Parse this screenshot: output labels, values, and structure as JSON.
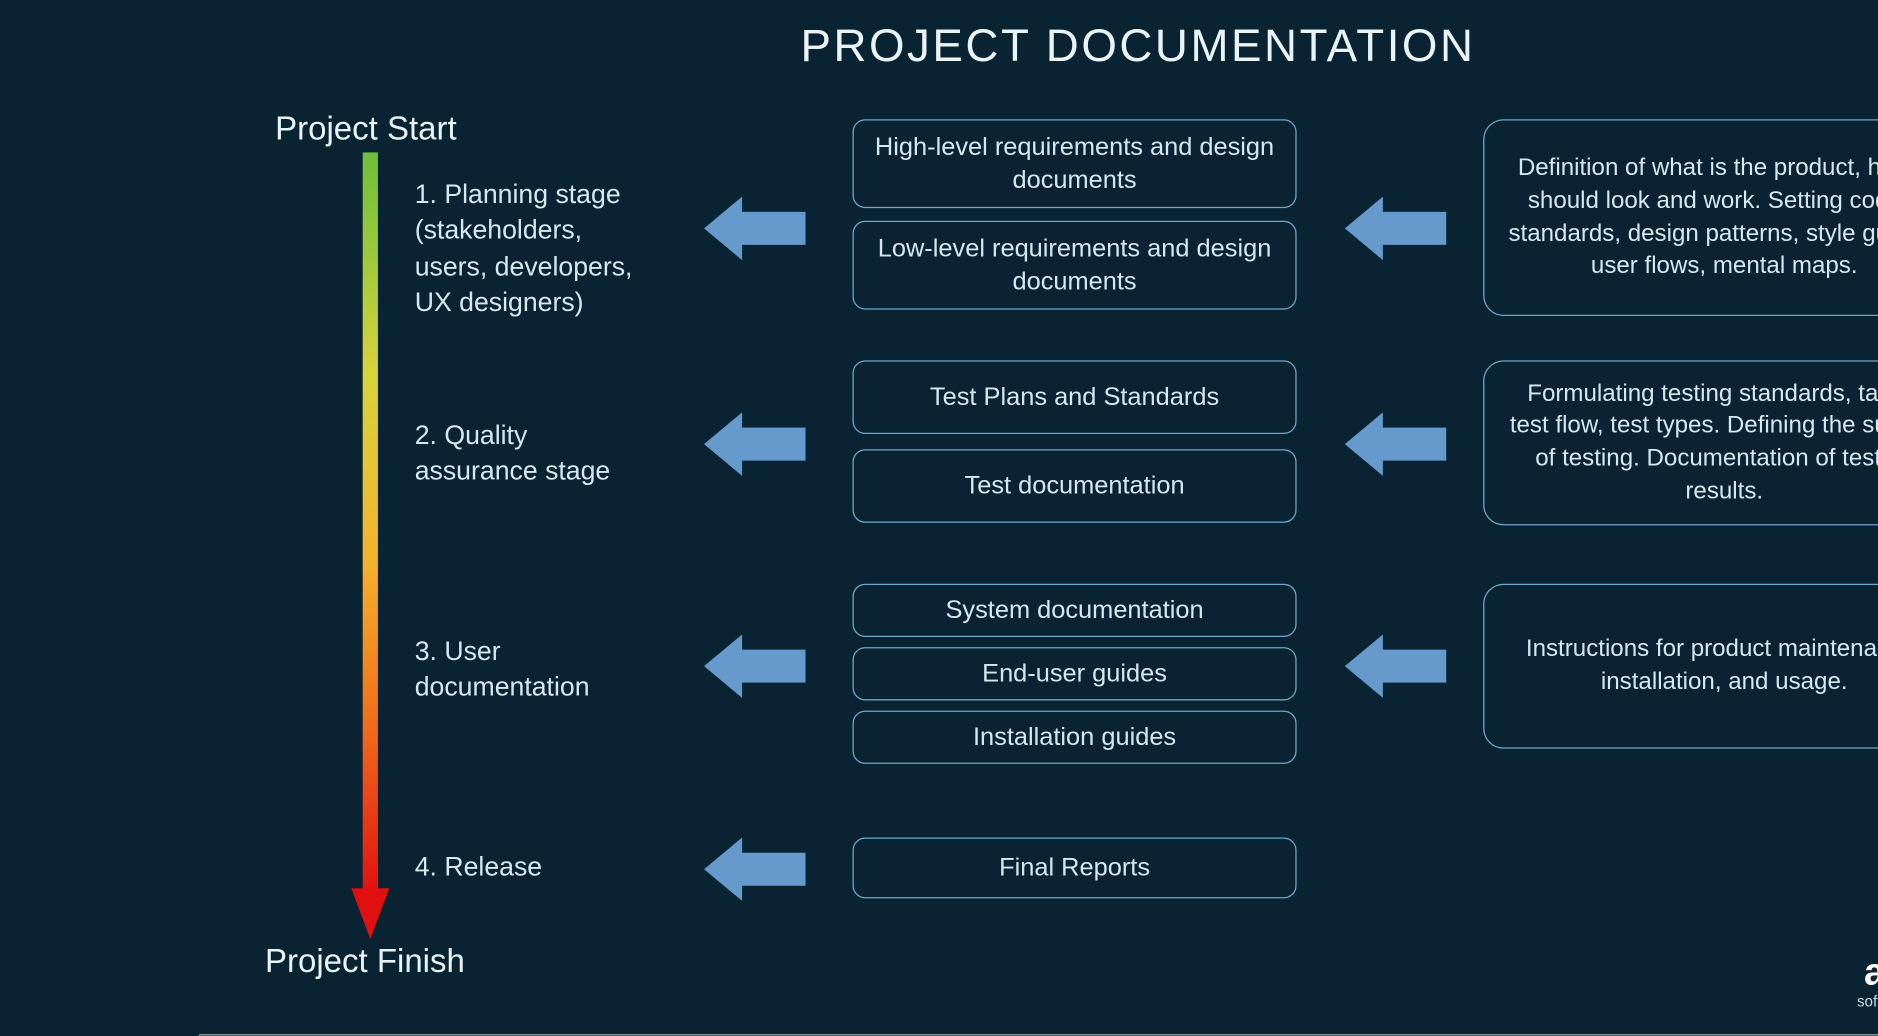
{
  "title": "PROJECT DOCUMENTATION",
  "timeline": {
    "start": "Project Start",
    "finish": "Project Finish"
  },
  "stages": [
    {
      "label": "1. Planning stage\n(stakeholders,\nusers, developers,\nUX designers)",
      "documents": [
        "High-level requirements and design documents",
        "Low-level requirements and design documents"
      ],
      "description": "Definition of what is the product, how it should look and work. Setting coding standards, design patterns, style guides, user flows, mental maps."
    },
    {
      "label": "2. Quality\nassurance stage",
      "documents": [
        "Test Plans and Standards",
        "Test documentation"
      ],
      "description": "Formulating testing standards, tasks, test flow, test types. Defining the subject of testing. Documentation of testing results."
    },
    {
      "label": "3. User\ndocumentation",
      "documents": [
        "System documentation",
        "End-user guides",
        "Installation guides"
      ],
      "description": "Instructions for product maintenance, installation, and usage."
    },
    {
      "label": "4. Release",
      "documents": [
        "Final Reports"
      ],
      "description": null
    }
  ],
  "brand": {
    "name": "altexsoft",
    "tagline": "software r&d engineering"
  },
  "colors": {
    "bg": "#0a2333",
    "text": "#d4e8f0",
    "border": "#6fa8c7",
    "arrow": "#6699cc"
  }
}
